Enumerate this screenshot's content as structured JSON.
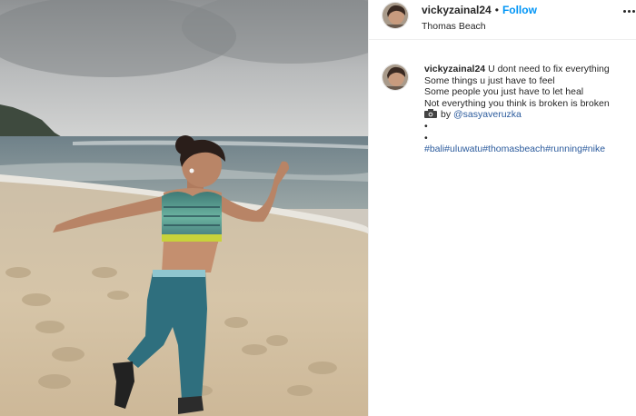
{
  "post": {
    "username": "vickyzainal24",
    "separator": "•",
    "follow_label": "Follow",
    "location": "Thomas Beach",
    "more_icon": "more-options-icon"
  },
  "caption": {
    "username": "vickyzainal24",
    "first_line": "U dont need to fix everything",
    "lines": [
      "Some things u just have to feel",
      "Some people you just have to let heal",
      "Not everything you think is broken is broken"
    ],
    "credit_icon": "camera-icon",
    "credit_by": "by",
    "credit_handle": "@sasyaveruzka",
    "bullets": [
      "•",
      "•"
    ],
    "hashtags": "#bali#uluwatu#thomasbeach#running#nike"
  },
  "colors": {
    "accent": "#0095f6",
    "link": "#2a5a9c",
    "text": "#262626"
  }
}
